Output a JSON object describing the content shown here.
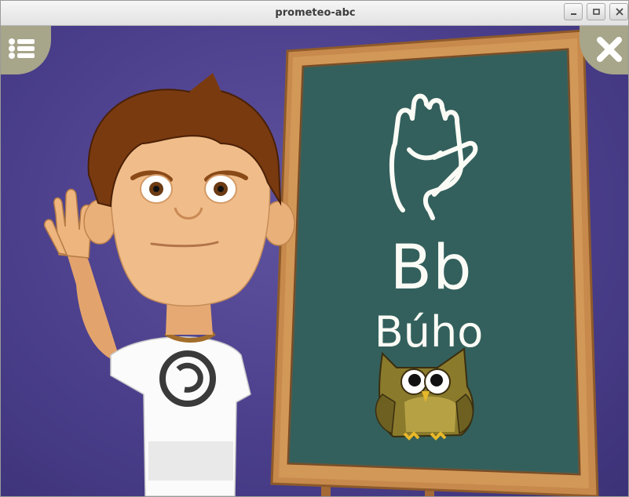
{
  "window": {
    "title": "prometeo-abc",
    "controls": [
      "minimize-icon",
      "maximize-icon",
      "close-icon"
    ]
  },
  "toolbar": {
    "menu_icon": "list-menu-icon",
    "close_icon": "close-x-icon"
  },
  "board": {
    "letters": "Bb",
    "word": "Búho",
    "sign_icon": "hand-sign-icon",
    "picture_icon": "owl-icon"
  },
  "colors": {
    "background": "#4b3f8c",
    "chalkboard": "#2f5a57",
    "frame": "#c98d4d",
    "corner_buttons": "#a7a58a",
    "chalk": "#fbfbf6"
  }
}
